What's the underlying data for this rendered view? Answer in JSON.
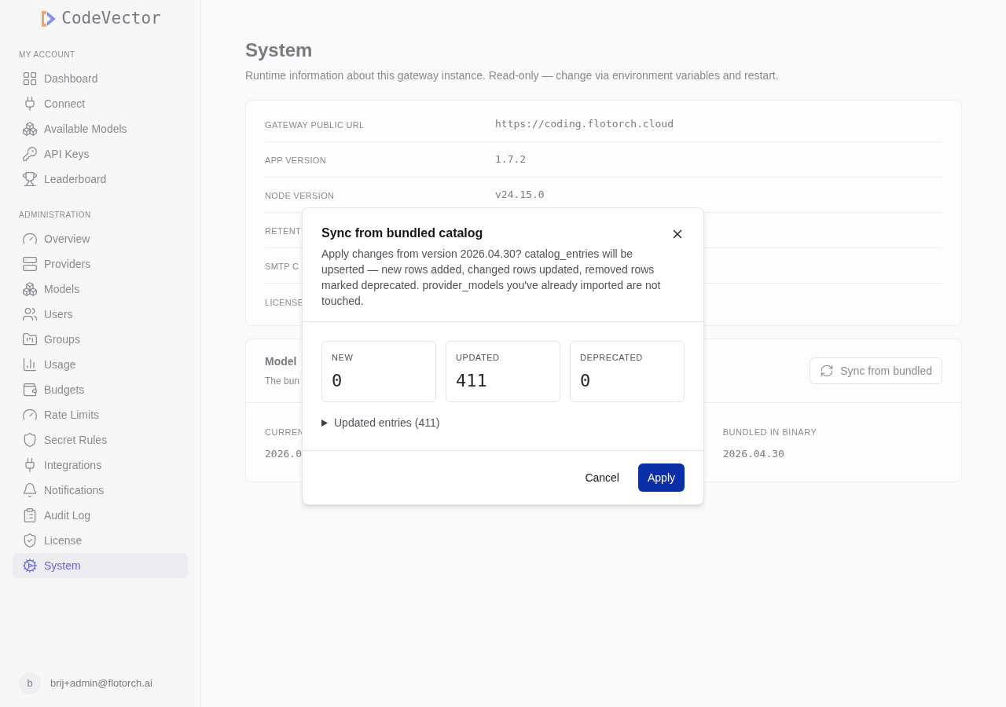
{
  "sidebar": {
    "logo_text": "CodeVector",
    "sections": [
      {
        "heading": "MY ACCOUNT",
        "items": [
          {
            "label": "Dashboard",
            "selected": false
          },
          {
            "label": "Connect",
            "selected": false
          },
          {
            "label": "Available Models",
            "selected": false
          },
          {
            "label": "API Keys",
            "selected": false
          },
          {
            "label": "Leaderboard",
            "selected": false
          }
        ]
      },
      {
        "heading": "ADMINISTRATION",
        "items": [
          {
            "label": "Overview",
            "selected": false
          },
          {
            "label": "Providers",
            "selected": false
          },
          {
            "label": "Models",
            "selected": false
          },
          {
            "label": "Users",
            "selected": false
          },
          {
            "label": "Groups",
            "selected": false
          },
          {
            "label": "Usage",
            "selected": false
          },
          {
            "label": "Budgets",
            "selected": false
          },
          {
            "label": "Rate Limits",
            "selected": false
          },
          {
            "label": "Secret Rules",
            "selected": false
          },
          {
            "label": "Integrations",
            "selected": false
          },
          {
            "label": "Notifications",
            "selected": false
          },
          {
            "label": "Audit Log",
            "selected": false
          },
          {
            "label": "License",
            "selected": false
          },
          {
            "label": "System",
            "selected": true
          }
        ]
      }
    ],
    "user": {
      "initial": "b",
      "email": "brij+admin@flotorch.ai"
    }
  },
  "page": {
    "title": "System",
    "subtitle": "Runtime information about this gateway instance. Read-only — change via environment variables and restart.",
    "info_rows": [
      {
        "label": "GATEWAY PUBLIC URL",
        "value": "https://coding.flotorch.cloud"
      },
      {
        "label": "APP VERSION",
        "value": "1.7.2"
      },
      {
        "label": "NODE VERSION",
        "value": "v24.15.0"
      },
      {
        "label": "RETENT"
      },
      {
        "label": "SMTP C"
      },
      {
        "label": "LICENSE"
      }
    ],
    "catalog_card": {
      "title": "Model",
      "subtitle": "The bun",
      "sync_button": "Sync from bundled",
      "columns": [
        {
          "label": "CURREN",
          "value": "2026.0"
        },
        {
          "label": "BUNDLED IN BINARY",
          "value": "2026.04.30"
        }
      ]
    }
  },
  "modal": {
    "title": "Sync from bundled catalog",
    "description": "Apply changes from version 2026.04.30? catalog_entries will be upserted — new rows added, changed rows updated, removed rows marked deprecated. provider_models you've already imported are not touched.",
    "stats": [
      {
        "label": "NEW",
        "value": "0"
      },
      {
        "label": "UPDATED",
        "value": "411"
      },
      {
        "label": "DEPRECATED",
        "value": "0"
      }
    ],
    "disclosure": {
      "label": "Updated entries (411)",
      "expanded": false
    },
    "buttons": {
      "cancel": "Cancel",
      "apply": "Apply"
    }
  }
}
